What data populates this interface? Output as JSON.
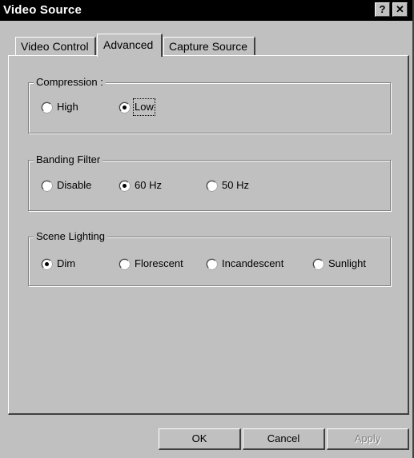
{
  "window": {
    "title": "Video Source"
  },
  "titlebar": {
    "help_label": "?",
    "close_label": "✕"
  },
  "tabs": [
    {
      "label": "Video Control",
      "selected": false
    },
    {
      "label": "Advanced",
      "selected": true
    },
    {
      "label": "Capture Source",
      "selected": false
    }
  ],
  "compression": {
    "legend": "Compression :",
    "options": [
      {
        "label": "High",
        "checked": false
      },
      {
        "label": "Low",
        "checked": true
      }
    ]
  },
  "banding": {
    "legend": "Banding Filter",
    "options": [
      {
        "label": "Disable",
        "checked": false
      },
      {
        "label": "60 Hz",
        "checked": true
      },
      {
        "label": "50 Hz",
        "checked": false
      }
    ]
  },
  "lighting": {
    "legend": "Scene Lighting",
    "options": [
      {
        "label": "Dim",
        "checked": true
      },
      {
        "label": "Florescent",
        "checked": false
      },
      {
        "label": "Incandescent",
        "checked": false
      },
      {
        "label": "Sunlight",
        "checked": false
      }
    ]
  },
  "buttons": {
    "ok": "OK",
    "cancel": "Cancel",
    "apply": "Apply"
  }
}
